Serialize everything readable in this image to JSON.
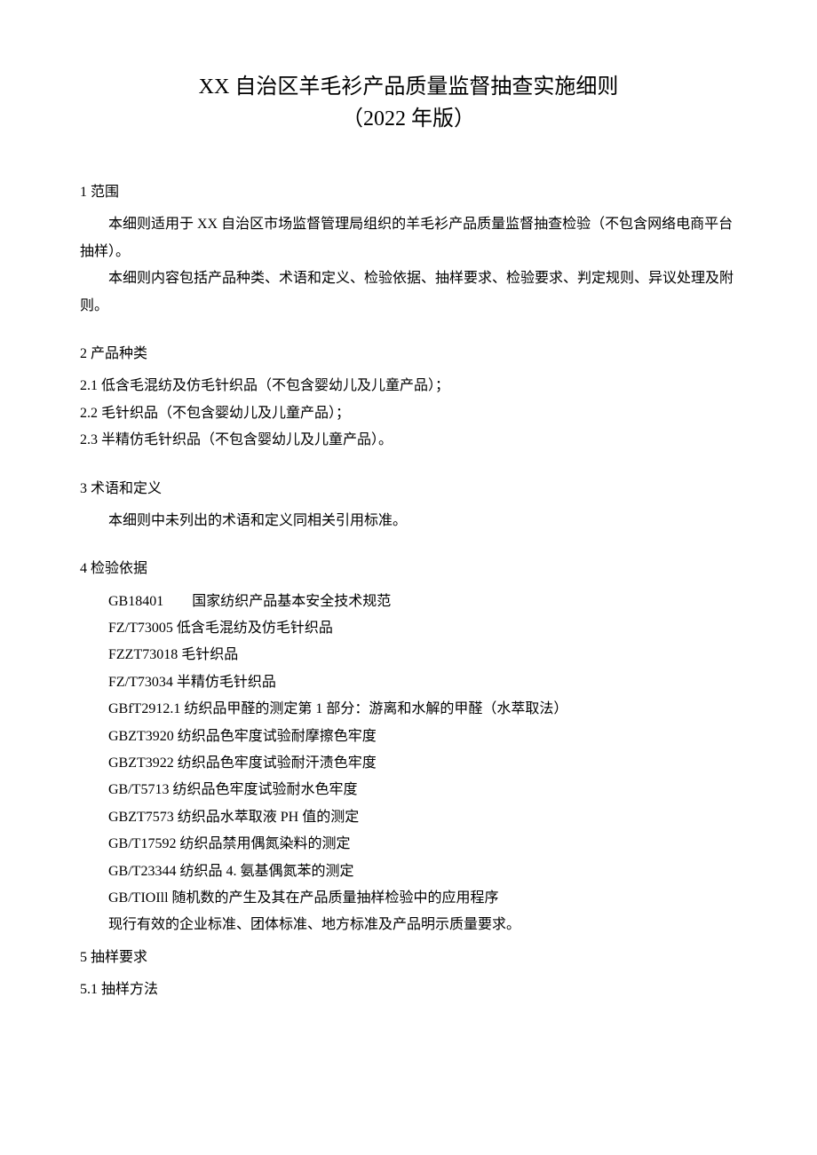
{
  "title": {
    "line1": "XX 自治区羊毛衫产品质量监督抽查实施细则",
    "line2": "（2022 年版）"
  },
  "s1": {
    "heading": "1 范围",
    "p1": "本细则适用于 XX 自治区市场监督管理局组织的羊毛衫产品质量监督抽查检验（不包含网络电商平台抽样）。",
    "p2": "本细则内容包括产品种类、术语和定义、检验依据、抽样要求、检验要求、判定规则、异议处理及附则。"
  },
  "s2": {
    "heading": "2 产品种类",
    "items": [
      "2.1   低含毛混纺及仿毛针织品（不包含婴幼儿及儿童产品）；",
      "2.2   毛针织品（不包含婴幼儿及儿童产品）；",
      "2.3   半精仿毛针织品（不包含婴幼儿及儿童产品）。"
    ]
  },
  "s3": {
    "heading": "3 术语和定义",
    "p1": "本细则中未列出的术语和定义同相关引用标准。"
  },
  "s4": {
    "heading": "4 检验依据",
    "items": [
      "GB18401  国家纺织产品基本安全技术规范",
      "FZ/T73005 低含毛混纺及仿毛针织品",
      "FZZT73018 毛针织品",
      "FZ/T73034 半精仿毛针织品",
      "GBfT2912.1 纺织品甲醛的测定第 1 部分：游离和水解的甲醛（水萃取法）",
      "GBZT3920 纺织品色牢度试验耐摩擦色牢度",
      "GBZT3922 纺织品色牢度试验耐汗渍色牢度",
      "GB/T5713 纺织品色牢度试验耐水色牢度",
      "GBZT7573 纺织品水萃取液 PH 值的测定",
      "GB/T17592 纺织品禁用偶氮染料的测定",
      "GB/T23344 纺织品 4. 氨基偶氮苯的测定",
      "GB/TIOIll 随机数的产生及其在产品质量抽样检验中的应用程序",
      "现行有效的企业标准、团体标准、地方标准及产品明示质量要求。"
    ]
  },
  "s5": {
    "heading": "5 抽样要求",
    "sub": "5.1   抽样方法"
  }
}
